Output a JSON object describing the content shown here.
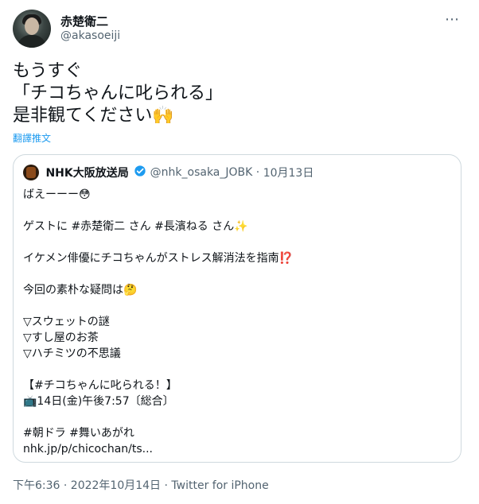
{
  "author": {
    "display_name": "赤楚衛二",
    "handle": "@akasoeiji",
    "more_icon": "⋯"
  },
  "tweet": {
    "lines": [
      "もうすぐ",
      "「チコちゃんに叱られる」",
      "是非観てください🙌"
    ],
    "translate_label": "翻譯推文"
  },
  "quoted": {
    "display_name": "NHK大阪放送局",
    "handle": "@nhk_osaka_JOBK",
    "separator": "·",
    "date": "10月13日",
    "lines": [
      "ばえーーー😳",
      "",
      "ゲストに #赤楚衛二 さん #長濱ねる さん✨",
      "",
      "イケメン俳優にチコちゃんがストレス解消法を指南⁉️",
      "",
      "今回の素朴な疑問は🤔",
      "",
      "▽スウェットの謎",
      "▽すし屋のお茶",
      "▽ハチミツの不思議",
      "",
      "【#チコちゃんに叱られる！】",
      "📺14日(金)午後7:57〔総合〕",
      "",
      "#朝ドラ #舞いあがれ",
      "nhk.jp/p/chicochan/ts..."
    ]
  },
  "footer": {
    "timestamp": "下午6:36 · 2022年10月14日 · Twitter for iPhone"
  },
  "colors": {
    "text": "#0f1419",
    "secondary": "#536471",
    "link": "#1d9bf0",
    "border": "#cfd9de"
  }
}
